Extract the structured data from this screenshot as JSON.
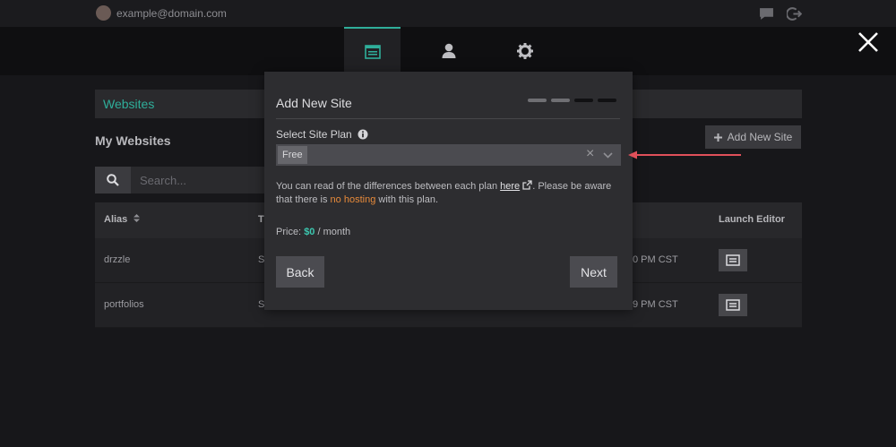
{
  "user": {
    "email": "example@domain.com"
  },
  "top_icons": [
    "chat-icon",
    "logout-icon"
  ],
  "nav": {
    "tabs": [
      "websites-tab",
      "account-tab",
      "settings-tab"
    ],
    "active_index": 0
  },
  "breadcrumb": {
    "label": "Websites"
  },
  "page": {
    "title": "My Websites",
    "add_button": "Add New Site",
    "search_placeholder": "Search..."
  },
  "table": {
    "headers": {
      "alias": "Alias",
      "title": "Ti",
      "launch": "Launch Editor"
    },
    "rows": [
      {
        "alias": "drzzle",
        "title": "St",
        "updated": "0 PM CST"
      },
      {
        "alias": "portfolios",
        "title": "St",
        "updated": "9 PM CST"
      }
    ]
  },
  "modal": {
    "title": "Add New Site",
    "steps_total": 4,
    "steps_done": 2,
    "field_label": "Select Site Plan",
    "selected_plan": "Free",
    "info_before_link": "You can read of the differences between each plan ",
    "info_link": "here",
    "info_after_link": ". Please be aware that there is ",
    "info_warn": "no hosting",
    "info_end": " with this plan.",
    "price_label": "Price: ",
    "price_amount": "$0",
    "price_unit": " / month",
    "back_label": "Back",
    "next_label": "Next"
  },
  "colors": {
    "accent": "#2fae9a",
    "warning": "#e78a3a",
    "arrow": "#e0505a"
  }
}
